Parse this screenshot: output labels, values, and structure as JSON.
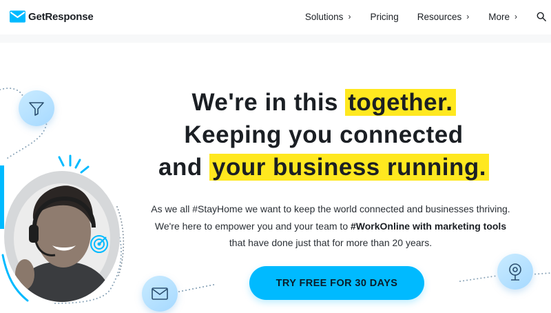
{
  "header": {
    "logo_text": "GetResponse",
    "nav": [
      {
        "label": "Solutions",
        "chevron": "›"
      },
      {
        "label": "Pricing",
        "chevron": ""
      },
      {
        "label": "Resources",
        "chevron": "›"
      },
      {
        "label": "More",
        "chevron": "›"
      }
    ],
    "search_icon": "search-icon"
  },
  "hero": {
    "line1_pre": "We're in this ",
    "line1_hl": "together.",
    "line2": "Keeping you connected",
    "line3_pre": "and ",
    "line3_hl": "your business running.",
    "body1": "As we all #StayHome we want to keep the world connected and businesses thriving.",
    "body2_pre": "We're here to empower you and your team to ",
    "body2_bold": "#WorkOnline with marketing tools",
    "body3": "that have done just that for more than 20 years.",
    "cta": "TRY FREE FOR 30 DAYS"
  },
  "colors": {
    "brand": "#00baff",
    "highlight": "#ffe81f",
    "icon_circle": "#b7e1ff"
  },
  "icons": [
    "logo-icon",
    "funnel-icon",
    "target-icon",
    "mail-icon",
    "webcam-icon",
    "headset-person-photo"
  ]
}
